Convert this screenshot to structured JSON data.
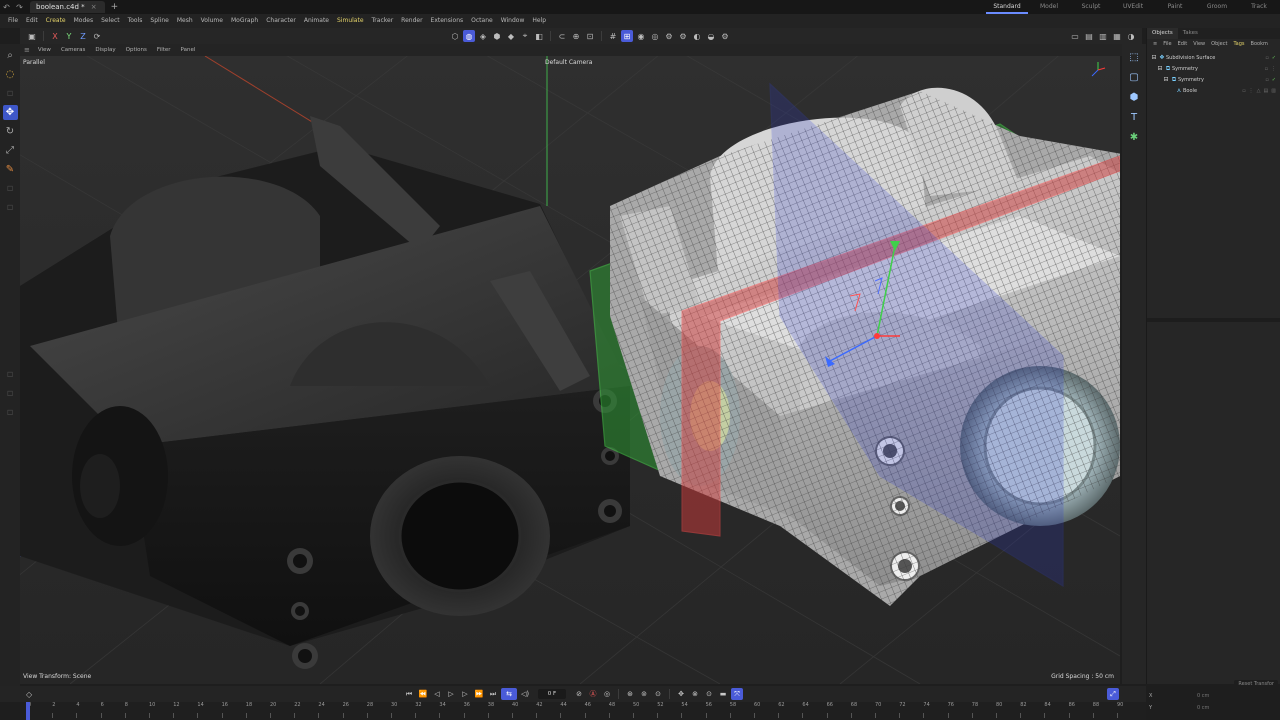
{
  "titlebar": {
    "file_name": "boolean.c4d *",
    "layouts": [
      "Standard",
      "Model",
      "Sculpt",
      "UVEdit",
      "Paint",
      "Groom",
      "Track"
    ],
    "active_layout": "Standard"
  },
  "menu": [
    "File",
    "Edit",
    "Create",
    "Modes",
    "Select",
    "Tools",
    "Spline",
    "Mesh",
    "Volume",
    "MoGraph",
    "Character",
    "Animate",
    "Simulate",
    "Tracker",
    "Render",
    "Extensions",
    "Octane",
    "Window",
    "Help"
  ],
  "toolbar": {
    "axis_x": "X",
    "axis_y": "Y",
    "axis_z": "Z"
  },
  "viewport_menu": [
    "View",
    "Cameras",
    "Display",
    "Options",
    "Filter",
    "Panel"
  ],
  "viewport": {
    "projection": "Parallel",
    "camera": "Default Camera",
    "view_transform": "View Transform: Scene",
    "grid_spacing": "Grid Spacing : 50 cm"
  },
  "objects_panel": {
    "tabs": [
      "Objects",
      "Takes"
    ],
    "menu": [
      "File",
      "Edit",
      "View",
      "Object",
      "Tags",
      "Bookm"
    ],
    "tree": [
      {
        "label": "Subdivision Surface",
        "depth": 0
      },
      {
        "label": "Symmetry",
        "depth": 1
      },
      {
        "label": "Symmetry",
        "depth": 2
      },
      {
        "label": "Boole",
        "depth": 3
      }
    ],
    "attr_button": "Reset Transfor",
    "coords": [
      {
        "axis": "X",
        "value": "0 cm"
      },
      {
        "axis": "Y",
        "value": "0 cm"
      }
    ]
  },
  "timeline": {
    "current_frame": "0 F",
    "ticks": [
      "0",
      "2",
      "4",
      "6",
      "8",
      "10",
      "12",
      "14",
      "16",
      "18",
      "20",
      "22",
      "24",
      "26",
      "28",
      "30",
      "32",
      "34",
      "36",
      "38",
      "40",
      "42",
      "44",
      "46",
      "48",
      "50",
      "52",
      "54",
      "56",
      "58",
      "60",
      "62",
      "64",
      "66",
      "68",
      "70",
      "72",
      "74",
      "76",
      "78",
      "80",
      "82",
      "84",
      "86",
      "88",
      "90"
    ]
  },
  "colors": {
    "accent": "#4a5bd8",
    "viewport_bg": "#2c2c2c",
    "panel_bg": "#262626",
    "symmetry_plane_green": "#3ea83e",
    "symmetry_plane_red": "#d03a3a",
    "symmetry_plane_blue": "#2a36c8"
  }
}
